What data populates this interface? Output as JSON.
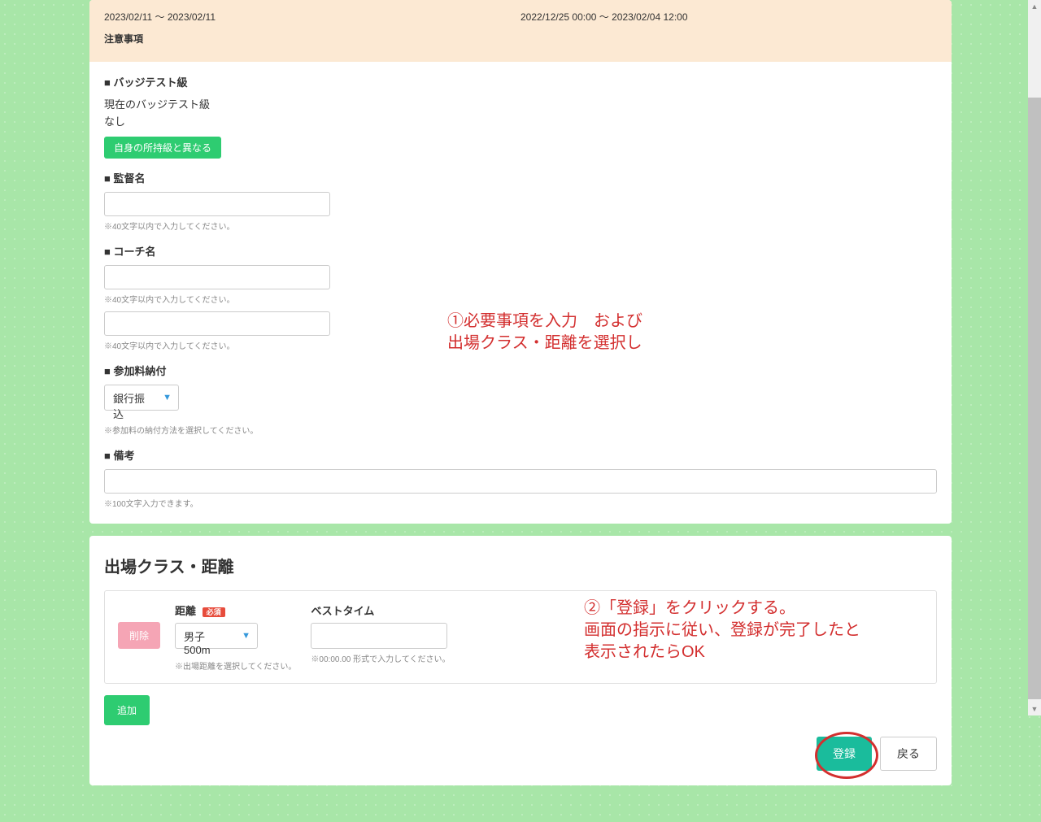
{
  "info": {
    "date_range": "2023/02/11 ～ 2023/02/11",
    "reg_range": "2022/12/25 00:00 ～ 2023/02/04 12:00",
    "notes_label": "注意事項"
  },
  "badge": {
    "section": "■ バッジテスト級",
    "current_label": "現在のバッジテスト級",
    "current_value": "なし",
    "button": "自身の所持級と異なる"
  },
  "supervisor": {
    "section": "■ 監督名",
    "help": "※40文字以内で入力してください。"
  },
  "coach": {
    "section": "■ コーチ名",
    "help1": "※40文字以内で入力してください。",
    "help2": "※40文字以内で入力してください。"
  },
  "payment": {
    "section": "■ 参加料納付",
    "value": "銀行振込",
    "help": "※参加料の納付方法を選択してください。"
  },
  "remarks": {
    "section": "■ 備考",
    "help": "※100文字入力できます。"
  },
  "class": {
    "title": "出場クラス・距離",
    "delete": "削除",
    "distance_label": "距離",
    "required": "必須",
    "distance_value": "男子500m",
    "distance_help": "※出場距離を選択してください。",
    "best_label": "ベストタイム",
    "best_help": "※00:00.00 形式で入力してください。",
    "add": "追加"
  },
  "actions": {
    "register": "登録",
    "back": "戻る"
  },
  "annotations": {
    "anno1": "①必要事項を入力　および\n出場クラス・距離を選択し",
    "anno2": "②「登録」をクリックする。\n画面の指示に従い、登録が完了したと\n表示されたらOK"
  }
}
